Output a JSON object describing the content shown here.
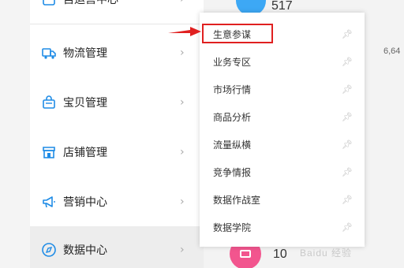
{
  "sidebar": {
    "items": [
      {
        "label": "自运营中心",
        "icon": "handbag-icon"
      },
      {
        "label": "物流管理",
        "icon": "truck-icon"
      },
      {
        "label": "宝贝管理",
        "icon": "bag-icon"
      },
      {
        "label": "店铺管理",
        "icon": "store-icon"
      },
      {
        "label": "营销中心",
        "icon": "megaphone-icon"
      },
      {
        "label": "数据中心",
        "icon": "compass-icon"
      }
    ],
    "active_index": 5,
    "chevron": "›"
  },
  "stats": {
    "top_value": "517",
    "bottom_value": "10",
    "side_value": "6,64"
  },
  "flyout": {
    "items": [
      {
        "label": "生意参谋"
      },
      {
        "label": "业务专区"
      },
      {
        "label": "市场行情"
      },
      {
        "label": "商品分析"
      },
      {
        "label": "流量纵横"
      },
      {
        "label": "竞争情报"
      },
      {
        "label": "数据作战室"
      },
      {
        "label": "数据学院"
      }
    ],
    "highlighted_index": 0
  },
  "watermark": "Baidu 经验",
  "colors": {
    "accent_blue": "#3da8f5",
    "accent_pink": "#f2558e",
    "highlight_red": "#e02020"
  }
}
